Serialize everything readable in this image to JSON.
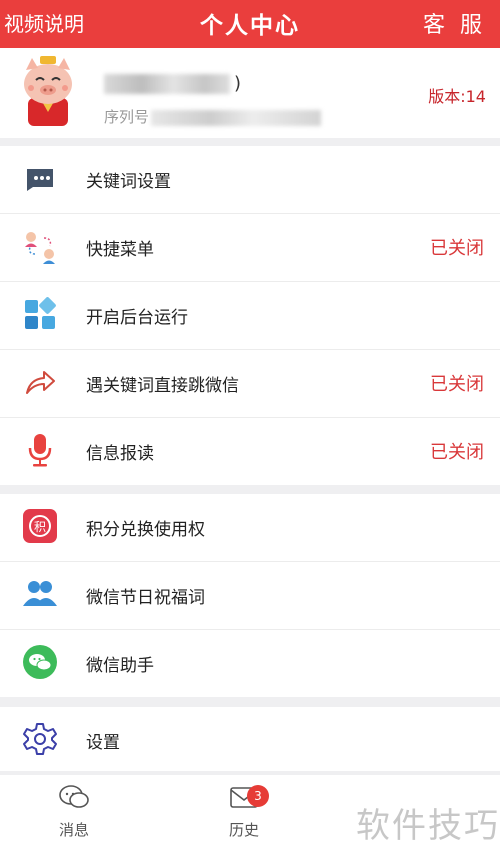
{
  "header": {
    "left": "视频说明",
    "title": "个人中心",
    "right": "客 服"
  },
  "profile": {
    "name_suffix": ")",
    "serial_label": "序列号",
    "version": "版本:14"
  },
  "group1": [
    {
      "label": "关键词设置",
      "status": ""
    },
    {
      "label": "快捷菜单",
      "status": "已关闭"
    },
    {
      "label": "开启后台运行",
      "status": ""
    },
    {
      "label": "遇关键词直接跳微信",
      "status": "已关闭"
    },
    {
      "label": "信息报读",
      "status": "已关闭"
    }
  ],
  "group2": [
    {
      "label": "积分兑换使用权"
    },
    {
      "label": "微信节日祝福词"
    },
    {
      "label": "微信助手"
    }
  ],
  "group3": [
    {
      "label": "设置"
    }
  ],
  "tabbar": {
    "messages": "消息",
    "history": "历史",
    "badge": "3"
  },
  "watermark": "软件技巧",
  "colors": {
    "accent": "#ea3e3d",
    "status": "#d9383a"
  }
}
